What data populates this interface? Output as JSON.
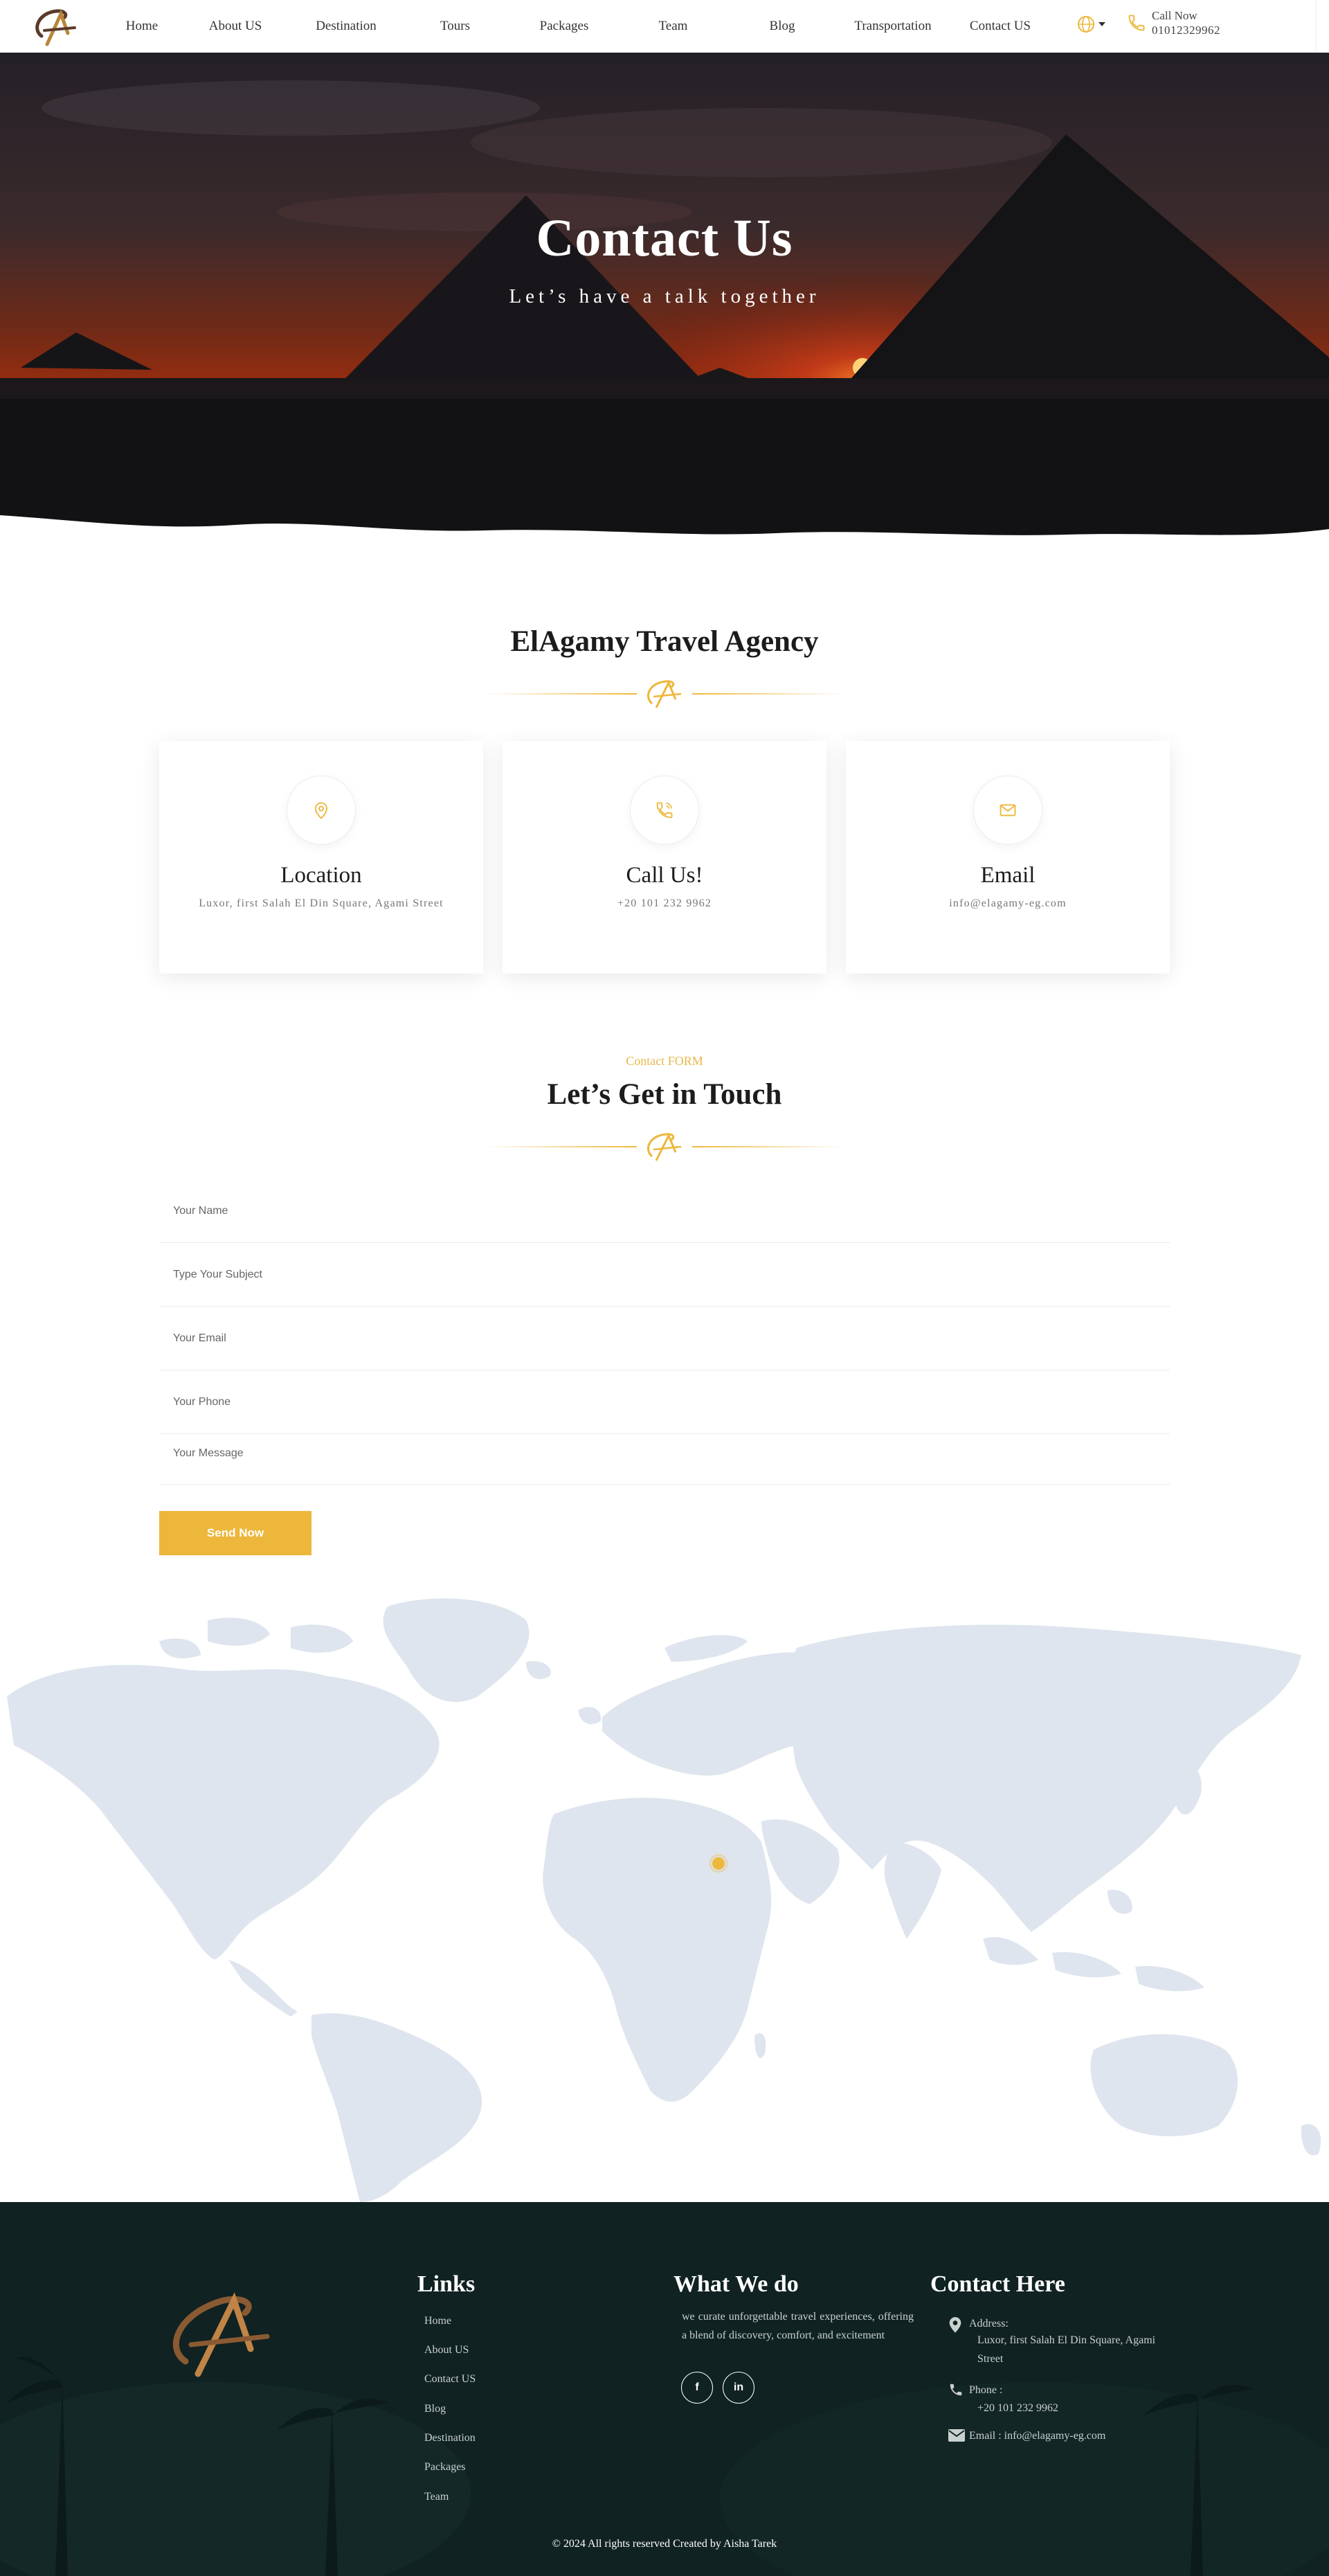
{
  "nav": {
    "links": [
      "Home",
      "About US",
      "Destination",
      "Tours",
      "Packages",
      "Team",
      "Blog",
      "Transportation",
      "Contact US"
    ],
    "call_label": "Call Now",
    "call_number": "01012329962"
  },
  "hero": {
    "title": "Contact Us",
    "subtitle": "Let’s have a talk together"
  },
  "agency": {
    "title": "ElAgamy Travel Agency",
    "cards": [
      {
        "title": "Location",
        "value": "Luxor, first Salah El Din Square, Agami Street",
        "icon": "location-pin-icon"
      },
      {
        "title": "Call Us!",
        "value": "+20 101 232 9962",
        "icon": "phone-icon"
      },
      {
        "title": "Email",
        "value": "info@elagamy-eg.com",
        "icon": "envelope-icon"
      }
    ]
  },
  "form": {
    "kicker": "Contact FORM",
    "title": "Let’s Get in Touch",
    "name_placeholder": "Your Name",
    "subject_placeholder": "Type Your Subject",
    "email_placeholder": "Your Email",
    "phone_placeholder": "Your Phone",
    "message_placeholder": "Your Message",
    "send_label": "Send Now"
  },
  "footer": {
    "links_title": "Links",
    "links": [
      "Home",
      "About US",
      "Contact US",
      "Blog",
      "Destination",
      "Packages",
      "Team"
    ],
    "what_title": "What We do",
    "what_text": "we curate unforgettable travel experiences, offering a blend of discovery, comfort, and excitement",
    "social": [
      {
        "icon": "facebook-icon",
        "glyph": "f"
      },
      {
        "icon": "linkedin-icon",
        "glyph": "in"
      }
    ],
    "contact_title": "Contact Here",
    "address_label": "Address:",
    "address_value": "Luxor, first Salah El Din Square, Agami Street",
    "phone_label": "Phone :",
    "phone_value": "+20 101 232 9962",
    "email_line": "Email : info@elagamy-eg.com",
    "copyright": "© 2024 All rights reserved Created by Aisha Tarek"
  },
  "colors": {
    "accent": "#edb73b",
    "footer_bg": "#0f2121",
    "map_land": "#dfe5ee"
  }
}
